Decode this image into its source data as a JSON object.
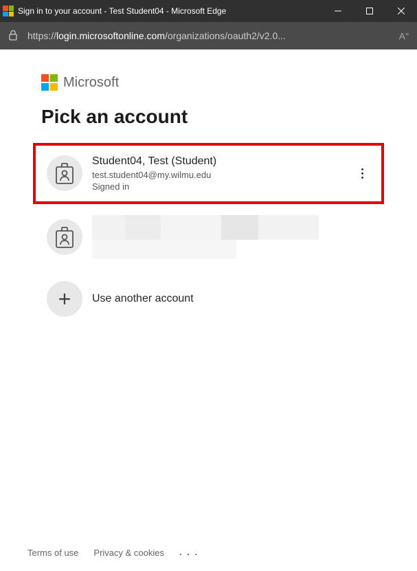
{
  "window": {
    "title": "Sign in to your account - Test Student04 - Microsoft Edge"
  },
  "address": {
    "scheme": "https://",
    "host": "login.microsoftonline.com",
    "path": "/organizations/oauth2/v2.0..."
  },
  "brand": "Microsoft",
  "heading": "Pick an account",
  "accounts": [
    {
      "name": "Student04, Test (Student)",
      "email": "test.student04@my.wilmu.edu",
      "status": "Signed in"
    }
  ],
  "use_another": "Use another account",
  "footer": {
    "terms": "Terms of use",
    "privacy": "Privacy & cookies"
  }
}
